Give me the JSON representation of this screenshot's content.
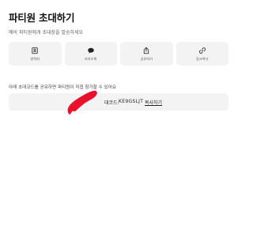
{
  "page": {
    "title": "파티원 초대하기",
    "subtitle": "예비 파티원에게 초대장을 발송하세요"
  },
  "share_options": [
    {
      "label": "연락처",
      "icon": "contact-book-icon"
    },
    {
      "label": "카카오톡",
      "icon": "speech-bubble-icon"
    },
    {
      "label": "공유하기",
      "icon": "share-icon"
    },
    {
      "label": "링크복사",
      "icon": "link-icon"
    }
  ],
  "invite_code": {
    "note": "아래 초대코드를 공유하면 파티원이 직접 참가할 수 있어요",
    "prefix_label": "대코드:",
    "code": "KE9GSLJT",
    "copy_label": "복사하기"
  },
  "colors": {
    "background": "#ffffff",
    "card_background": "#f3f3f4",
    "redaction": "#e8102a"
  }
}
